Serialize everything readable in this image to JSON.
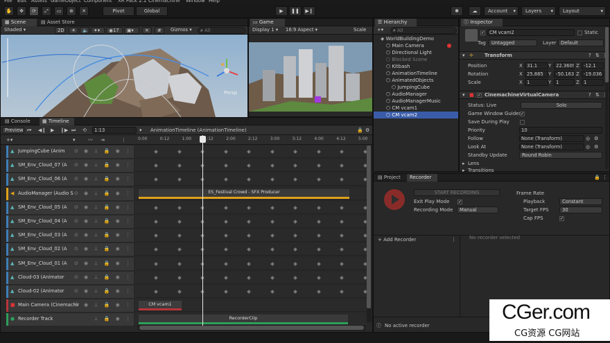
{
  "menubar": [
    "File",
    "Edit",
    "Assets",
    "GameObject",
    "Component",
    "XR Pack 2.1",
    "Cinemachine",
    "Window",
    "Help"
  ],
  "toolbar": {
    "pivot": "Pivot",
    "global": "Global",
    "account": "Account",
    "layers": "Layers",
    "layout": "Layout"
  },
  "scene": {
    "tab_scene": "Scene",
    "tab_asset": "Asset Store",
    "shaded": "Shaded",
    "mode2d": "2D",
    "hidden_count": "17",
    "gizmos": "Gizmos",
    "search_placeholder": "All",
    "persp": "Persp"
  },
  "game": {
    "tab": "Game",
    "display": "Display 1",
    "aspect": "16:9 Aspect",
    "scale": "Scale"
  },
  "hierarchy": {
    "tab": "Hierarchy",
    "search_placeholder": "All",
    "items": [
      {
        "label": "WorldBuildingDemo",
        "indent": 0,
        "state": "root"
      },
      {
        "label": "Main Camera",
        "indent": 1,
        "state": "normal"
      },
      {
        "label": "Directional Light",
        "indent": 1,
        "state": "normal"
      },
      {
        "label": "Blocked Scene",
        "indent": 1,
        "state": "dim"
      },
      {
        "label": "Kitbash",
        "indent": 1,
        "state": "normal"
      },
      {
        "label": "AnimationTimeline",
        "indent": 1,
        "state": "normal"
      },
      {
        "label": "AnimatedObjects",
        "indent": 1,
        "state": "normal"
      },
      {
        "label": "JumpingCube",
        "indent": 2,
        "state": "normal"
      },
      {
        "label": "AudioManager",
        "indent": 1,
        "state": "normal"
      },
      {
        "label": "AudioManagerMusic",
        "indent": 1,
        "state": "normal"
      },
      {
        "label": "CM vcam1",
        "indent": 1,
        "state": "normal"
      },
      {
        "label": "CM vcam2",
        "indent": 1,
        "state": "selected"
      }
    ]
  },
  "inspector": {
    "tab": "Inspector",
    "name": "CM vcam2",
    "static": "Static",
    "tag_label": "Tag",
    "tag": "Untagged",
    "layer_label": "Layer",
    "layer": "Default",
    "transform": {
      "title": "Transform",
      "position": "Position",
      "rotation": "Rotation",
      "scale": "Scale",
      "pos": {
        "x": "31.1",
        "y": "22.3609",
        "z": "-12.1"
      },
      "rot": {
        "x": "25.885",
        "y": "-50.163",
        "z": "-19.036"
      },
      "scl": {
        "x": "1",
        "y": "1",
        "z": "1"
      }
    },
    "cvc": {
      "title": "CinemachineVirtualCamera",
      "status_label": "Status: Live",
      "solo": "Solo",
      "guides": "Game Window Guides",
      "save_play": "Save During Play",
      "priority": "Priority",
      "priority_val": "10",
      "follow": "Follow",
      "follow_val": "None (Transform)",
      "lookat": "Look At",
      "lookat_val": "None (Transform)",
      "standby": "Standby Update",
      "standby_val": "Round Robin",
      "lens": "Lens",
      "transitions": "Transitions"
    }
  },
  "timeline": {
    "tab_console": "Console",
    "tab_timeline": "Timeline",
    "preview": "Preview",
    "frame": "1:13",
    "asset": "AnimationTimeline (AnimationTimeline)",
    "ruler": [
      "0:00",
      "0:12",
      "1:00",
      "1:12",
      "2:00",
      "2:12",
      "3:00",
      "3:12",
      "4:00",
      "4:12",
      "5:00"
    ],
    "tracks": [
      {
        "name": "JumpingCube (Anim",
        "color": "#3f7fb8",
        "kind": "anim"
      },
      {
        "name": "SM_Env_Cloud_07 (A",
        "color": "#3f7fb8",
        "kind": "anim"
      },
      {
        "name": "SM_Env_Cloud_06 (A",
        "color": "#3f7fb8",
        "kind": "anim"
      },
      {
        "name": "AudioManager (Audio S",
        "color": "#e0a21b",
        "kind": "audio"
      },
      {
        "name": "SM_Env_Cloud_05 (A",
        "color": "#3f7fb8",
        "kind": "anim"
      },
      {
        "name": "SM_Env_Cloud_04 (A",
        "color": "#3f7fb8",
        "kind": "anim"
      },
      {
        "name": "SM_Env_Cloud_03 (A",
        "color": "#3f7fb8",
        "kind": "anim"
      },
      {
        "name": "SM_Env_Cloud_02 (A",
        "color": "#3f7fb8",
        "kind": "anim"
      },
      {
        "name": "SM_Env_Cloud_01 (A",
        "color": "#3f7fb8",
        "kind": "anim"
      },
      {
        "name": "Cloud-03 (Animator",
        "color": "#3f7fb8",
        "kind": "anim"
      },
      {
        "name": "Cloud-02 (Animator",
        "color": "#3f7fb8",
        "kind": "anim"
      },
      {
        "name": "Main Camera (Cinemachine",
        "color": "#b8343a",
        "kind": "cine"
      },
      {
        "name": "Recorder Track",
        "color": "#2e9e5b",
        "kind": "rec"
      }
    ],
    "audio_clip": "ES_Festival Crowd - SFX Producer",
    "cine_clip": "CM vcam1",
    "rec_clip": "RecorderClip"
  },
  "recorder": {
    "tab_project": "Project",
    "tab_recorder": "Recorder",
    "start": "START RECORDING",
    "exit_play": "Exit Play Mode",
    "rec_mode": "Recording Mode",
    "rec_mode_val": "Manual",
    "frame_rate": "Frame Rate",
    "playback": "Playback",
    "playback_val": "Constant",
    "target_fps": "Target FPS",
    "target_fps_val": "30",
    "cap_fps": "Cap FPS",
    "add": "+ Add Recorder",
    "none_selected": "No recorder selected",
    "status": "No active recorder"
  },
  "watermark": {
    "line1": "CGer.com",
    "line2": "CG资源 CG网站"
  }
}
